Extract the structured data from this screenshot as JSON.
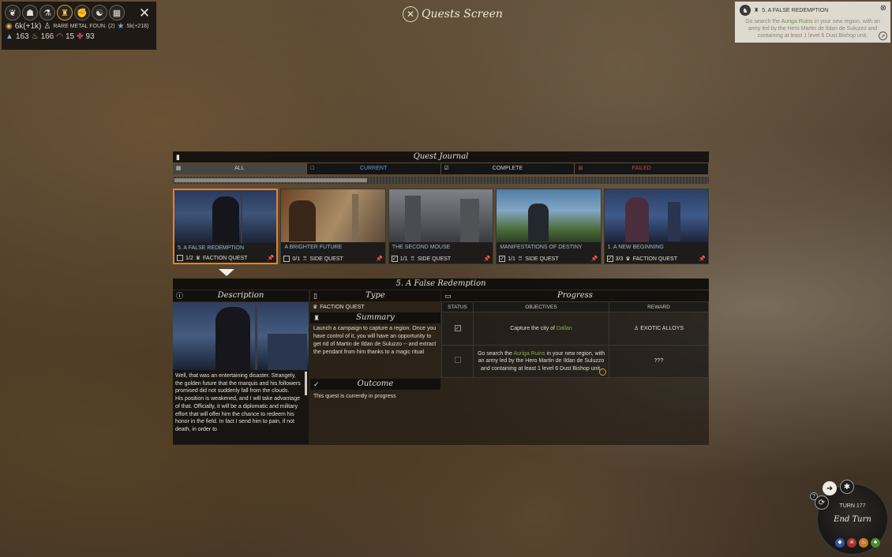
{
  "screen": {
    "title": "Quests Screen"
  },
  "resources": {
    "icons": [
      "laurel-icon",
      "population-icon",
      "science-icon",
      "trophy-icon",
      "fist-icon",
      "diplomacy-icon",
      "treasury-icon"
    ],
    "dust": "6k(+1k)",
    "strategic_resource": "RARE METAL FOUN. (2)",
    "influence": "5k(+218)",
    "food": "163",
    "industry": "166",
    "science": "15",
    "approval": "93"
  },
  "notification": {
    "title": "5. A FALSE REDEMPTION",
    "body_prefix": "Go search the ",
    "body_highlight": "Auriga Ruins",
    "body_suffix": " in your new region, with an army led by the Hero Martin de Ildan de Suluzzo and containing at least 1 level 6 Dust Bishop unit."
  },
  "journal": {
    "title": "Quest Journal",
    "tabs": [
      {
        "label": "ALL"
      },
      {
        "label": "CURRENT"
      },
      {
        "label": "COMPLETE"
      },
      {
        "label": "FAILED"
      }
    ],
    "scroll_progress": 0.36,
    "cards": [
      {
        "title": "5. A FALSE REDEMPTION",
        "progress": "1/2",
        "type": "FACTION QUEST",
        "checked": false
      },
      {
        "title": "A BRIGHTER FUTURE",
        "progress": "0/1",
        "type": "SIDE QUEST",
        "checked": false
      },
      {
        "title": "THE SECOND MOUSE",
        "progress": "1/1",
        "type": "SIDE QUEST",
        "checked": true
      },
      {
        "title": "MANIFESTATIONS OF DESTINY",
        "progress": "1/1",
        "type": "SIDE QUEST",
        "checked": true
      },
      {
        "title": "1. A NEW BEGINNING",
        "progress": "3/3",
        "type": "FACTION QUEST",
        "checked": true
      }
    ]
  },
  "details": {
    "title": "5. A False Redemption",
    "description_header": "Description",
    "description": "Well, that was an entertaining disaster. Strangely, the golden future that the marquis and his followers promised did not suddenly fall from the clouds.\nHis position is weakened, and I will take advantage of that. Officially, it will be a diplomatic and military effort that will offer him the chance to redeem his honor in the field.  In fact I send him to pain, if not death, in order to",
    "type_header": "Type",
    "type_value": "FACTION QUEST",
    "summary_header": "Summary",
    "summary": "Launch a campaign to capture a region.  Once you have control of it, you will have an opportunity to get rid of Martin de Ildan de Suluzzo -- and extract the pendant from him thanks to a magic ritual",
    "outcome_header": "Outcome",
    "outcome": "This quest is currently in progress",
    "progress_header": "Progress",
    "columns": {
      "status": "STATUS",
      "objectives": "OBJECTIVES",
      "reward": "REWARD"
    },
    "rows": [
      {
        "done": true,
        "objective_prefix": "Capture the city of ",
        "objective_highlight": "Dallan",
        "objective_suffix": "",
        "reward": "EXOTIC ALLOYS"
      },
      {
        "done": false,
        "objective_prefix": "Go search the ",
        "objective_highlight": "Auriga Ruins",
        "objective_suffix": " in your new region, with an army led by the Hero Martin de Ildan de Suluzzo and containing at least 1 level 6 Dust Bishop unit.",
        "reward": "???"
      }
    ]
  },
  "turn": {
    "turn_label": "TURN 177",
    "end_turn_label": "End Turn",
    "help": "?"
  },
  "colors": {
    "accent": "#d9853a",
    "highlight_green": "#7bb04c",
    "current_blue": "#5ea0d6",
    "failed_red": "#d0443c"
  }
}
